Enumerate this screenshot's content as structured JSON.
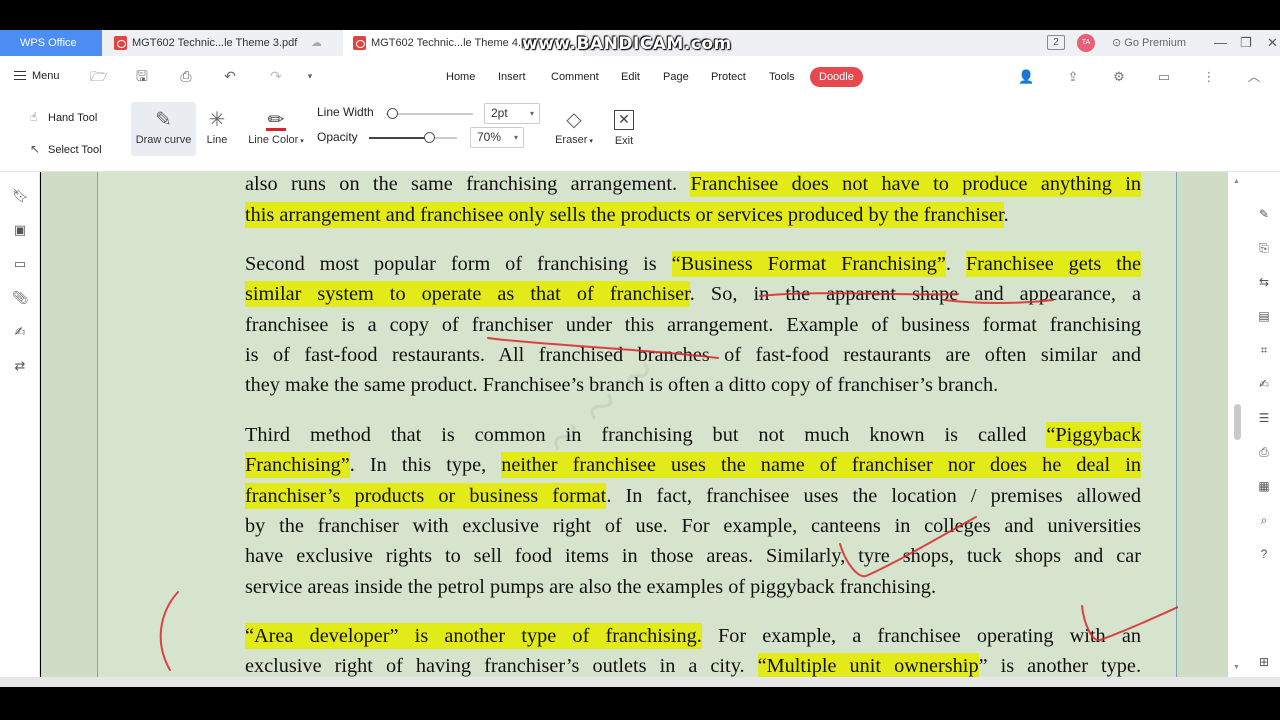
{
  "tabs": {
    "app": "WPS Office",
    "file1": "MGT602 Technic...le Theme 3.pdf",
    "file2": "MGT602 Technic...le Theme 4.pdf"
  },
  "watermark_overlay": "www.BANDICAM.com",
  "topbar": {
    "window_count": "2",
    "avatar_initials": "TA",
    "go_premium": "Go Premium"
  },
  "menu": {
    "menu_label": "Menu",
    "tabs": [
      "Home",
      "Insert",
      "Comment",
      "Edit",
      "Page",
      "Protect",
      "Tools",
      "Doodle"
    ],
    "active_tab": "Doodle"
  },
  "ribbon": {
    "hand_tool": "Hand Tool",
    "select_tool": "Select Tool",
    "draw_curve": "Draw curve",
    "line": "Line",
    "line_color": "Line Color",
    "line_width_label": "Line Width",
    "line_width_value": "2pt",
    "opacity_label": "Opacity",
    "opacity_value": "70%",
    "eraser": "Eraser",
    "exit": "Exit"
  },
  "document": {
    "lines": [
      [
        "also runs on the same franchising arrangement. ",
        "Franchisee does not have to produce anything in"
      ],
      [
        "this arrangement and franchisee only sells the products or services produced by the franchiser",
        "."
      ],
      [
        "Second most popular form of franchising is ",
        "“Business Format Franchising”",
        ". ",
        "Franchisee gets the"
      ],
      [
        "similar system to operate as that of franchiser",
        ". So, in the apparent shape and appearance, a"
      ],
      [
        "franchisee is a copy of franchiser under this arrangement. Example of business format franchising"
      ],
      [
        "is of fast-food restaurants. All franchised branches of fast-food restaurants are often similar and"
      ],
      [
        "they make the same product. Franchisee’s branch is often a ditto copy of franchiser’s branch."
      ],
      [
        "Third method that is common in franchising but not much known is called ",
        "“Piggyback"
      ],
      [
        "Franchising”",
        ". In this type, ",
        "neither franchisee uses the name of franchiser nor does he deal in"
      ],
      [
        "franchiser’s products or business format",
        ". In fact, franchisee uses the location / premises allowed"
      ],
      [
        "by the franchiser with exclusive right of use. For example, canteens in colleges and universities"
      ],
      [
        "have exclusive rights to sell food items in those areas. Similarly, tyre shops, tuck shops and car"
      ],
      [
        "service areas inside the petrol pumps are also the examples of piggyback franchising."
      ],
      [
        "“Area developer” is another type of franchising.",
        " For example, a franchisee operating with an"
      ],
      [
        "exclusive right of having franchiser’s outlets in a city. ",
        "“Multiple unit ownership",
        "” is another type."
      ]
    ]
  },
  "colors": {
    "highlight": "#e2ea18",
    "ink": "#d9262c",
    "page_bg": "#d6e3cd",
    "active_tab": "#e5484d"
  }
}
